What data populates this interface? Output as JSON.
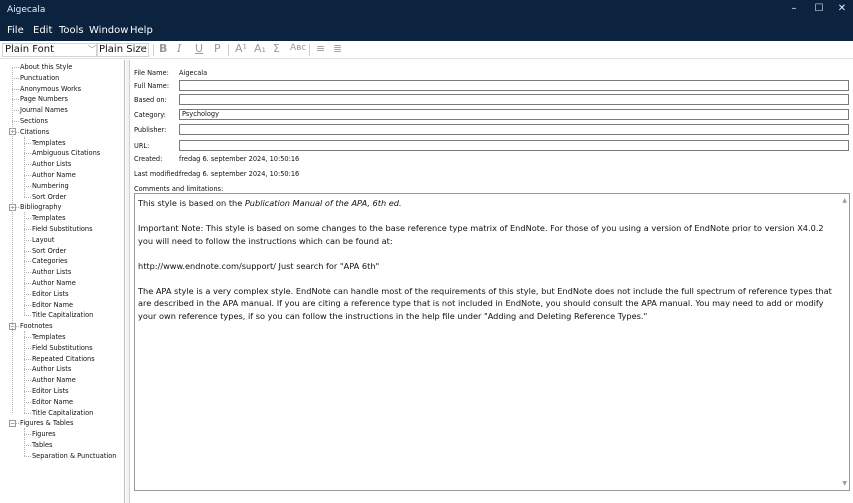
{
  "window": {
    "title": "Aigecala",
    "controls": {
      "minimize": "–",
      "maximize": "☐",
      "close": "✕"
    }
  },
  "menu": [
    "File",
    "Edit",
    "Tools",
    "Window",
    "Help"
  ],
  "toolbar": {
    "font": "Plain Font",
    "size": "Plain Size",
    "buttons": [
      {
        "icon": "bold-icon",
        "glyph": "B"
      },
      {
        "icon": "italic-icon",
        "glyph": "I"
      },
      {
        "icon": "underline-icon",
        "glyph": "U"
      },
      {
        "icon": "plain-icon",
        "glyph": "P"
      },
      {
        "icon": "superscript-icon",
        "glyph": "A¹"
      },
      {
        "icon": "subscript-icon",
        "glyph": "A₁"
      },
      {
        "icon": "symbol-icon",
        "glyph": "Σ"
      },
      {
        "icon": "smallcaps-icon",
        "glyph": "Aʙᴄ"
      },
      {
        "icon": "align-left-icon",
        "glyph": "≡"
      },
      {
        "icon": "align-center-icon",
        "glyph": "≣"
      }
    ]
  },
  "sidebar": {
    "items": [
      {
        "label": "About this Style",
        "level": 0
      },
      {
        "label": "Punctuation",
        "level": 0
      },
      {
        "label": "Anonymous Works",
        "level": 0
      },
      {
        "label": "Page Numbers",
        "level": 0
      },
      {
        "label": "Journal Names",
        "level": 0
      },
      {
        "label": "Sections",
        "level": 0
      },
      {
        "label": "Citations",
        "level": 0,
        "expander": "⊟"
      },
      {
        "label": "Templates",
        "level": 1
      },
      {
        "label": "Ambiguous Citations",
        "level": 1
      },
      {
        "label": "Author Lists",
        "level": 1
      },
      {
        "label": "Author Name",
        "level": 1
      },
      {
        "label": "Numbering",
        "level": 1
      },
      {
        "label": "Sort Order",
        "level": 1
      },
      {
        "label": "Bibliography",
        "level": 0,
        "expander": "⊟"
      },
      {
        "label": "Templates",
        "level": 1
      },
      {
        "label": "Field Substitutions",
        "level": 1
      },
      {
        "label": "Layout",
        "level": 1
      },
      {
        "label": "Sort Order",
        "level": 1
      },
      {
        "label": "Categories",
        "level": 1
      },
      {
        "label": "Author Lists",
        "level": 1
      },
      {
        "label": "Author Name",
        "level": 1
      },
      {
        "label": "Editor Lists",
        "level": 1
      },
      {
        "label": "Editor Name",
        "level": 1
      },
      {
        "label": "Title Capitalization",
        "level": 1
      },
      {
        "label": "Footnotes",
        "level": 0,
        "expander": "⊟"
      },
      {
        "label": "Templates",
        "level": 1
      },
      {
        "label": "Field Substitutions",
        "level": 1
      },
      {
        "label": "Repeated Citations",
        "level": 1
      },
      {
        "label": "Author Lists",
        "level": 1
      },
      {
        "label": "Author Name",
        "level": 1
      },
      {
        "label": "Editor Lists",
        "level": 1
      },
      {
        "label": "Editor Name",
        "level": 1
      },
      {
        "label": "Title Capitalization",
        "level": 1
      },
      {
        "label": "Figures & Tables",
        "level": 0,
        "expander": "⊟"
      },
      {
        "label": "Figures",
        "level": 1
      },
      {
        "label": "Tables",
        "level": 1
      },
      {
        "label": "Separation & Punctuation",
        "level": 1
      }
    ]
  },
  "form": {
    "file_name_label": "File Name:",
    "file_name_value": "Aigecala",
    "full_name_label": "Full Name:",
    "full_name_value": "",
    "based_on_label": "Based on:",
    "based_on_value": "",
    "category_label": "Category:",
    "category_value": "Psychology",
    "publisher_label": "Publisher:",
    "publisher_value": "",
    "url_label": "URL:",
    "url_value": "",
    "created_label": "Created:",
    "created_value": "fredag 6. september 2024, 10:50:16",
    "modified_label": "Last modified:",
    "modified_value": "fredag 6. september 2024, 10:50:16",
    "comments_label": "Comments and limitations:",
    "comments": {
      "p1_prefix": "This style is based on the ",
      "p1_italic": "Publication Manual of the APA, 6th ed.",
      "p2": "Important Note:  This style is based on some changes to the base reference type matrix of EndNote.  For those of you using a version of EndNote prior to version X4.0.2 you will need to follow the instructions which can be found at:",
      "p3": "http://www.endnote.com/support/    Just search for \"APA 6th\"",
      "p4": "The APA style is a very complex style.  EndNote can handle most of the requirements of this style, but EndNote does not include the full spectrum of reference types that are described in the APA manual.  If you are citing a reference type that is not included in EndNote, you should consult the APA manual.  You may need to add or modify your own reference types, if so you can follow the instructions in the help file under \"Adding and Deleting Reference Types.\""
    }
  }
}
